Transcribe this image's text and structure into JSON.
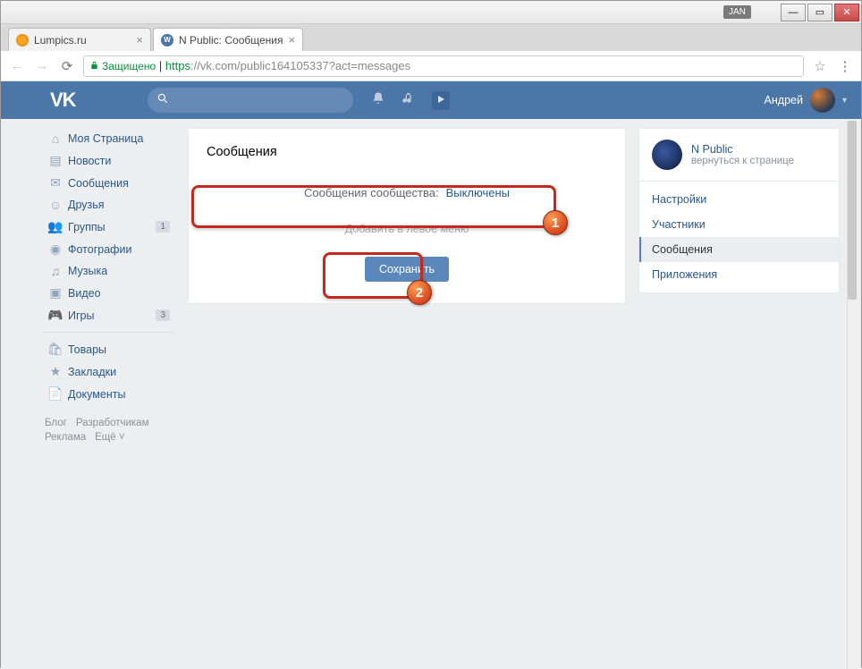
{
  "window": {
    "jan": "JAN"
  },
  "tabs": [
    {
      "title": "Lumpics.ru"
    },
    {
      "title": "N Public: Сообщения"
    }
  ],
  "address": {
    "secure": "Защищено",
    "scheme": "https",
    "rest": "://vk.com/public164105337?act=messages"
  },
  "header": {
    "logo": "VK",
    "username": "Андрей"
  },
  "nav": {
    "items": [
      {
        "label": "Моя Страница"
      },
      {
        "label": "Новости"
      },
      {
        "label": "Сообщения"
      },
      {
        "label": "Друзья"
      },
      {
        "label": "Группы",
        "badge": "1"
      },
      {
        "label": "Фотографии"
      },
      {
        "label": "Музыка"
      },
      {
        "label": "Видео"
      },
      {
        "label": "Игры",
        "badge": "3"
      }
    ],
    "items2": [
      {
        "label": "Товары"
      },
      {
        "label": "Закладки"
      },
      {
        "label": "Документы"
      }
    ],
    "footer": [
      "Блог",
      "Разработчикам",
      "Реклама",
      "Ещё ˅"
    ]
  },
  "main": {
    "title": "Сообщения",
    "settingLabel": "Сообщения сообщества:",
    "settingValue": "Выключены",
    "obscured": "Добавить в левое меню",
    "save": "Сохранить"
  },
  "right": {
    "name": "N Public",
    "back": "вернуться к странице",
    "items": [
      "Настройки",
      "Участники",
      "Сообщения",
      "Приложения"
    ]
  },
  "badges": {
    "b1": "1",
    "b2": "2"
  }
}
